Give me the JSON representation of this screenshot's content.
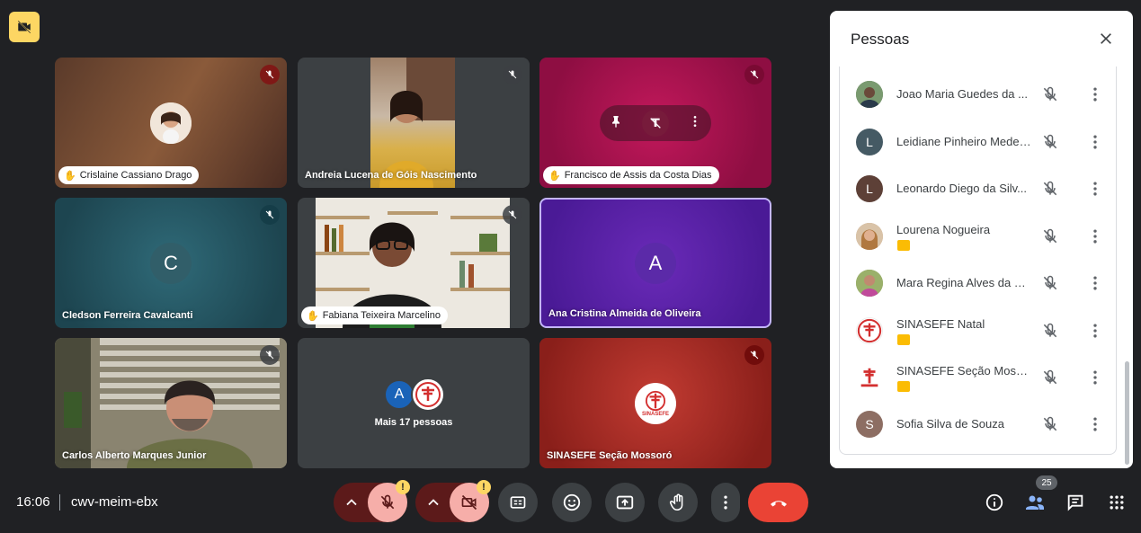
{
  "meeting": {
    "time": "16:06",
    "code": "cwv-meim-ebx"
  },
  "tiles": [
    {
      "name": "Crislaine Cassiano Drago"
    },
    {
      "name": "Andreia Lucena de Góis Nascimento"
    },
    {
      "name": "Francisco de Assis da Costa Dias"
    },
    {
      "name": "Cledson Ferreira Cavalcanti",
      "initial": "C"
    },
    {
      "name": "Fabiana Teixeira Marcelino"
    },
    {
      "name": "Ana Cristina Almeida de Oliveira",
      "initial": "A"
    },
    {
      "name": "Carlos Alberto Marques Junior"
    },
    {
      "name": "Mais 17 pessoas",
      "initial": "A"
    },
    {
      "name": "SINASEFE Seção Mossoró"
    }
  ],
  "logo_text": "SINASEFE",
  "panel": {
    "title": "Pessoas",
    "people": [
      {
        "name": "Joao Maria Guedes da ...",
        "initial": "",
        "color": "#5f7a55"
      },
      {
        "name": "Leidiane Pinheiro Medei...",
        "initial": "L",
        "color": "#455a64"
      },
      {
        "name": "Leonardo Diego da Silv...",
        "initial": "L",
        "color": "#5d4037"
      },
      {
        "name": "Lourena Nogueira",
        "initial": "",
        "color": "#c7a88a"
      },
      {
        "name": "Mara Regina Alves da C...",
        "initial": "",
        "color": "#8a9a5b"
      },
      {
        "name": "SINASEFE Natal",
        "initial": "",
        "color": "#ffffff"
      },
      {
        "name": "SINASEFE Seção Mosso...",
        "initial": "",
        "color": "#ffffff"
      },
      {
        "name": "Sofia Silva de Souza",
        "initial": "S",
        "color": "#8d6e63"
      }
    ]
  },
  "participants_count": "25",
  "warning_mark": "!",
  "colors": {
    "accent": "#8ab4f8",
    "end_call": "#ea4335",
    "warning": "#fdd663"
  }
}
